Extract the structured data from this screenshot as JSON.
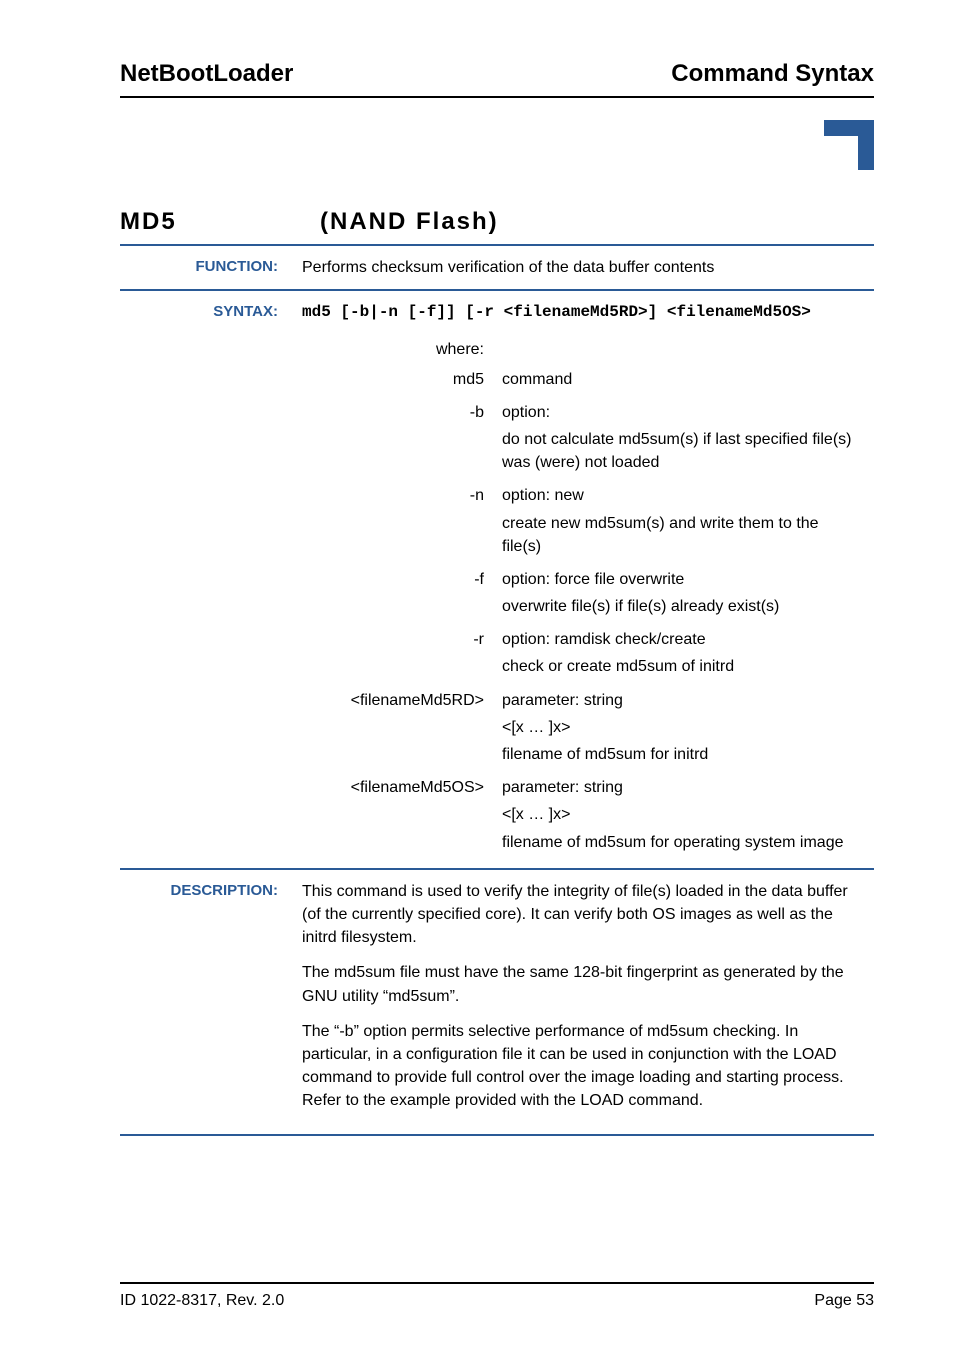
{
  "header": {
    "left": "NetBootLoader",
    "right": "Command Syntax"
  },
  "title": {
    "cmd": "MD5",
    "sub": "(NAND Flash)"
  },
  "rows": {
    "function": {
      "label": "FUNCTION:",
      "text": "Performs checksum verification of the data buffer contents"
    },
    "syntax": {
      "label": "SYNTAX:",
      "code": "md5 [-b|-n [-f]] [-r <filenameMd5RD>] <filenameMd5OS>",
      "where": "where:",
      "params": [
        {
          "name": "md5",
          "lines": [
            "command"
          ]
        },
        {
          "name": "-b",
          "lines": [
            "option:",
            "do not calculate md5sum(s) if last specified file(s) was (were) not loaded"
          ]
        },
        {
          "name": "-n",
          "lines": [
            "option: new",
            "create new md5sum(s) and write them to the file(s)"
          ]
        },
        {
          "name": "-f",
          "lines": [
            "option: force file overwrite",
            "overwrite file(s) if file(s) already exist(s)"
          ]
        },
        {
          "name": "-r",
          "lines": [
            "option: ramdisk check/create",
            "check or create md5sum of initrd"
          ]
        },
        {
          "name": "<filenameMd5RD>",
          "lines": [
            "parameter: string",
            "<[x … ]x>",
            "filename of md5sum for initrd"
          ]
        },
        {
          "name": "<filenameMd5OS>",
          "lines": [
            "parameter: string",
            "<[x … ]x>",
            "filename of md5sum for operating system image"
          ]
        }
      ]
    },
    "description": {
      "label": "DESCRIPTION:",
      "paras": [
        "This command is used to verify the integrity of file(s) loaded in the data buffer (of the currently specified core). It can verify both OS images as well as the initrd filesystem.",
        "The md5sum file must have the same 128-bit fingerprint as generated by the GNU utility “md5sum”.",
        "The “-b” option permits selective performance of md5sum checking. In particular, in a configuration file it can be used in conjunction with the LOAD command to provide full control over the image loading and starting process. Refer to the example provided with the LOAD command."
      ]
    }
  },
  "footer": {
    "left": "ID 1022-8317, Rev. 2.0",
    "right": "Page 53"
  }
}
